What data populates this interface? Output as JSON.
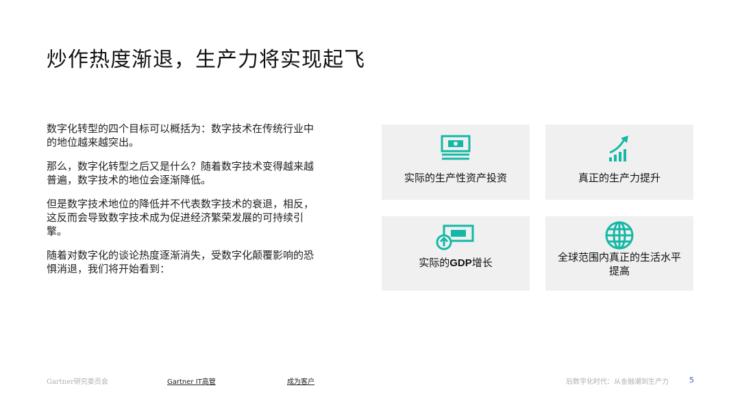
{
  "slide": {
    "title": "炒作热度渐退，生产力将实现起飞"
  },
  "body": {
    "paragraphs": [
      "数字化转型的四个目标可以概括为：数字技术在传统行业中的地位越来越突出。",
      "那么，数字化转型之后又是什么？随着数字技术变得越来越普遍，数字技术的地位会逐渐降低。",
      "但是数字技术地位的降低并不代表数字技术的衰退，相反，这反而会导致数字技术成为促进经济繁荣发展的可持续引擎。",
      "随着对数字化的谈论热度逐渐消失，受数字化颠覆影响的恐惧消退，我们将开始看到："
    ]
  },
  "cards": [
    {
      "label": "实际的生产性资产投资",
      "icon": "banknote-icon"
    },
    {
      "label": "真正的生产力提升",
      "icon": "growth-chart-icon"
    },
    {
      "label_prefix": "实际的",
      "label_bold": "GDP",
      "label_suffix": "增长",
      "icon": "money-up-arrow-icon"
    },
    {
      "label_line1": "全球范围内真正的生活水平",
      "label_line2": "提高",
      "icon": "globe-icon"
    }
  ],
  "footer": {
    "brand": "Gartner研究委员会",
    "link1": "Gartner IT高管",
    "link2": "成为客户",
    "report_title": "后数字化时代：从金融潮到生产力",
    "page_number": "5"
  },
  "colors": {
    "accent": "#14b8a6",
    "card_bg": "#f0f0f0",
    "page_number": "#3b4fb8"
  }
}
